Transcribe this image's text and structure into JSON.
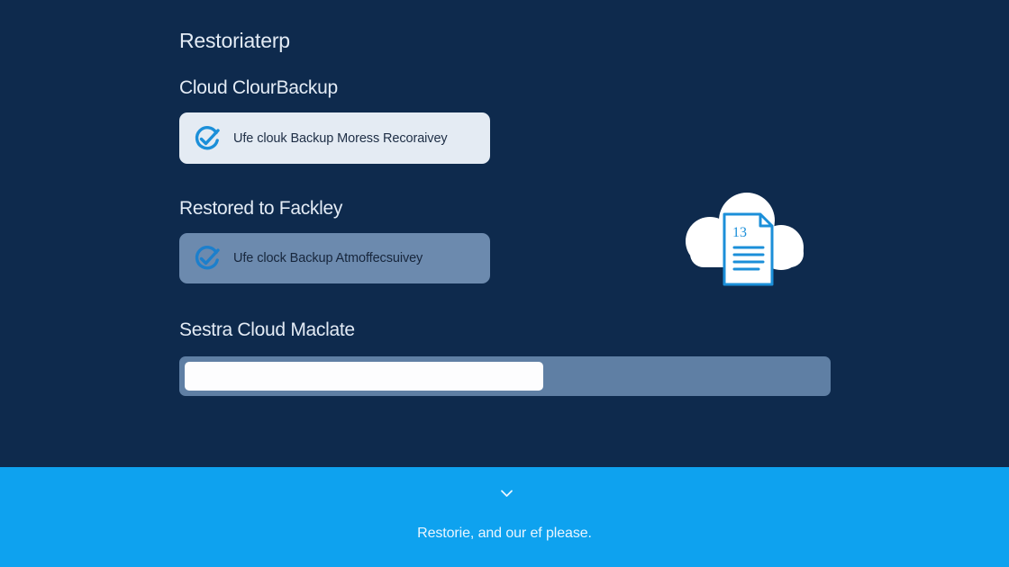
{
  "app": {
    "title": "Restoriaterp"
  },
  "sections": [
    {
      "heading": "Cloud ClourBackup",
      "option": {
        "label": "Ufe clouk Backup Moress Recoraivey",
        "icon": "check-circle-icon",
        "selected": true
      }
    },
    {
      "heading": "Restored to Fackley",
      "option": {
        "label": "Ufe clock Backup Atmoffecsuivey",
        "icon": "check-circle-icon",
        "selected": false
      }
    }
  ],
  "progress": {
    "heading": "Sestra Cloud Maclate",
    "percent": 56
  },
  "illustration": {
    "icon": "cloud-document-icon",
    "doc_number": "13"
  },
  "footer": {
    "icon": "chevron-down-icon",
    "text": "Restorie, and our ef please."
  },
  "colors": {
    "background": "#0e2a4d",
    "footer": "#0ea2ef",
    "accent": "#1b8fd9",
    "card_selected": "#e4ebf3",
    "card_unselected": "#6c8aae"
  }
}
